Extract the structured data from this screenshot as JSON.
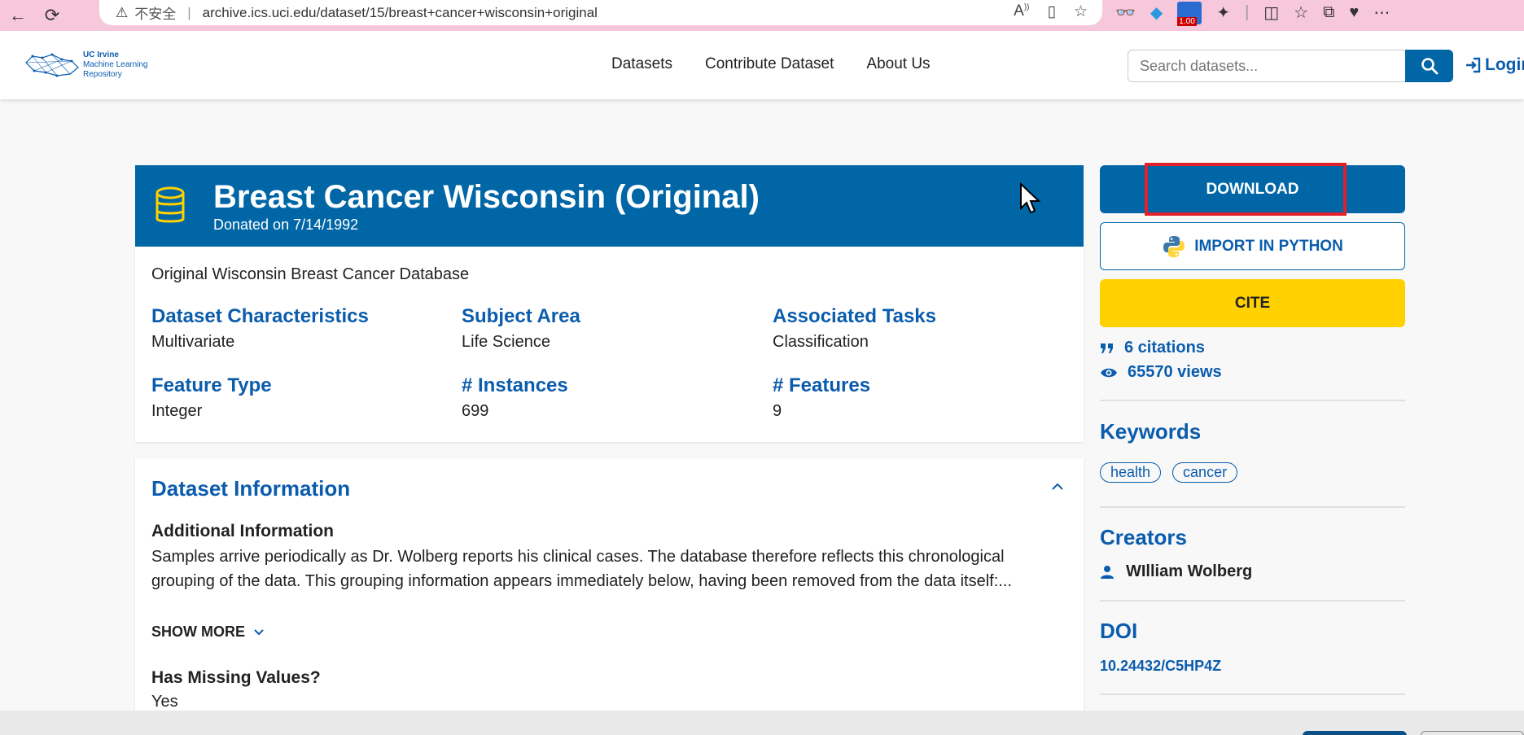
{
  "browser": {
    "insecure_label": "不安全",
    "separator": "|",
    "url": "archive.ics.uci.edu/dataset/15/breast+cancer+wisconsin+original",
    "ext_badge": "1.00"
  },
  "header": {
    "logo_line1": "UC Irvine",
    "logo_line2": "Machine Learning",
    "logo_line3": "Repository",
    "nav": [
      "Datasets",
      "Contribute Dataset",
      "About Us"
    ],
    "search_placeholder": "Search datasets...",
    "login_label": "Login"
  },
  "dataset": {
    "title": "Breast Cancer Wisconsin (Original)",
    "donated": "Donated on 7/14/1992",
    "description": "Original Wisconsin Breast Cancer Database",
    "characteristics": [
      {
        "label": "Dataset Characteristics",
        "value": "Multivariate"
      },
      {
        "label": "Subject Area",
        "value": "Life Science"
      },
      {
        "label": "Associated Tasks",
        "value": "Classification"
      },
      {
        "label": "Feature Type",
        "value": "Integer"
      },
      {
        "label": "# Instances",
        "value": "699"
      },
      {
        "label": "# Features",
        "value": "9"
      }
    ]
  },
  "info": {
    "heading": "Dataset Information",
    "additional_title": "Additional Information",
    "additional_body": "Samples arrive periodically as Dr. Wolberg reports his clinical cases. The database therefore reflects this chronological grouping of the data. This grouping information appears immediately below, having been removed from the data itself:...",
    "show_more": "SHOW MORE",
    "missing_title": "Has Missing Values?",
    "missing_value": "Yes"
  },
  "sidebar": {
    "download": "DOWNLOAD",
    "import_python": "IMPORT IN PYTHON",
    "cite": "CITE",
    "citations": "6 citations",
    "views": "65570 views",
    "keywords_heading": "Keywords",
    "keywords": [
      "health",
      "cancer"
    ],
    "creators_heading": "Creators",
    "creator": "WIlliam Wolberg",
    "doi_heading": "DOI",
    "doi": "10.24432/C5HP4Z"
  },
  "colors": {
    "primary": "#0066a6",
    "cite_yellow": "#ffd100",
    "highlight_red": "#e0202a",
    "chrome_pink": "#f7c8dc"
  }
}
